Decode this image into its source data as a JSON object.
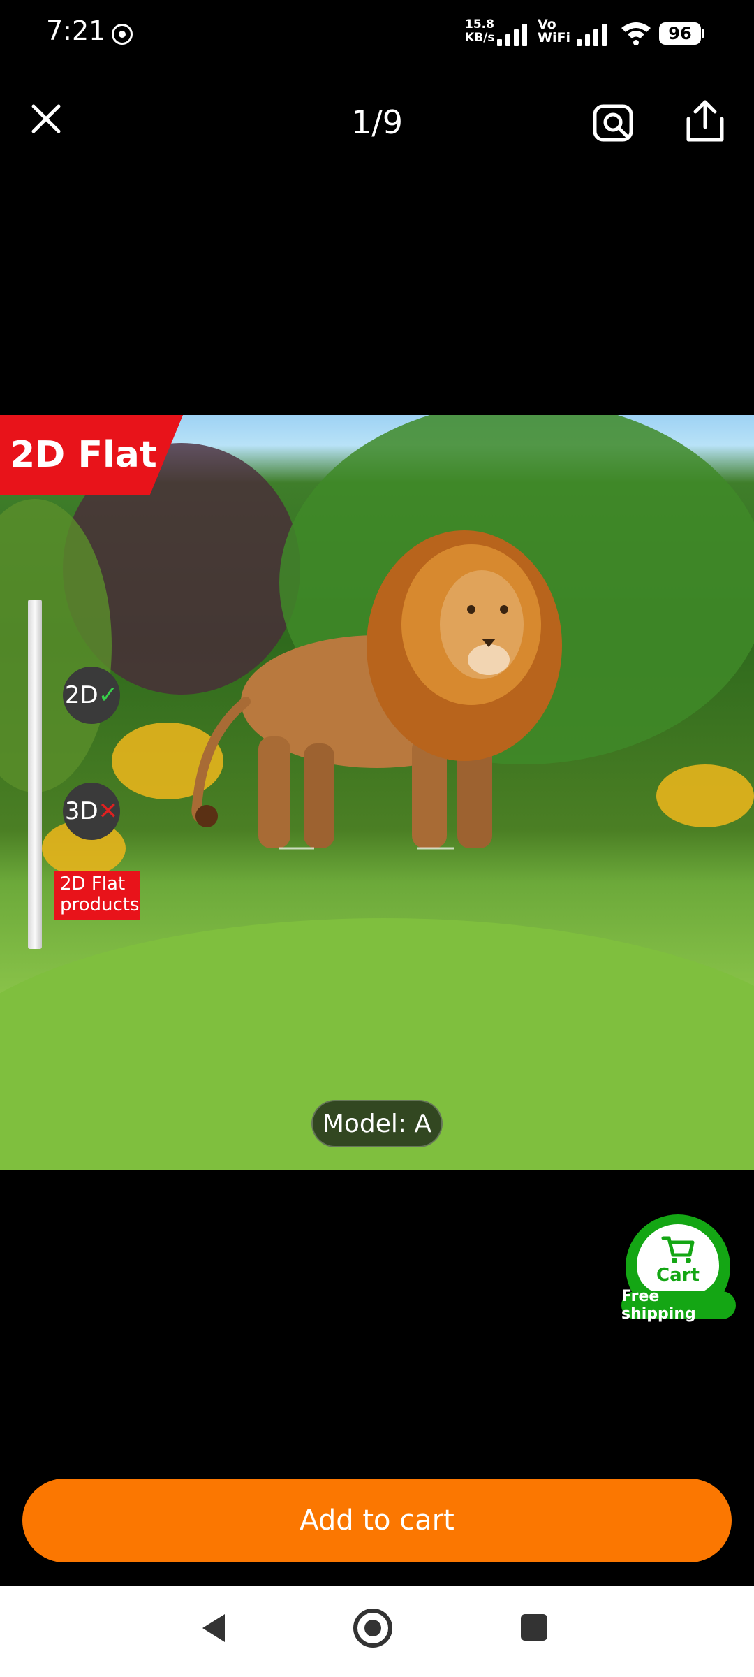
{
  "status_bar": {
    "time": "7:21",
    "net_speed_value": "15.8",
    "net_speed_unit": "KB/s",
    "vo_label": "Vo",
    "wifi_label": "WiFi",
    "battery": "96"
  },
  "header": {
    "page_indicator": "1/9"
  },
  "product_image": {
    "flat_tag": "2D Flat",
    "chip_2d": "2D",
    "chip_3d": "3D",
    "flat_products_line1": "2D Flat",
    "flat_products_line2": "products",
    "model_label": "Model: A"
  },
  "cart_float": {
    "label": "Cart",
    "badge": "Free shipping"
  },
  "actions": {
    "add_to_cart": "Add to cart"
  },
  "colors": {
    "accent_orange": "#fb7701",
    "cart_green": "#14a614",
    "tag_red": "#e8131a"
  },
  "icons": [
    "close-icon",
    "camera-search-icon",
    "share-icon",
    "cart-icon",
    "back-icon",
    "home-icon",
    "recent-apps-icon"
  ]
}
